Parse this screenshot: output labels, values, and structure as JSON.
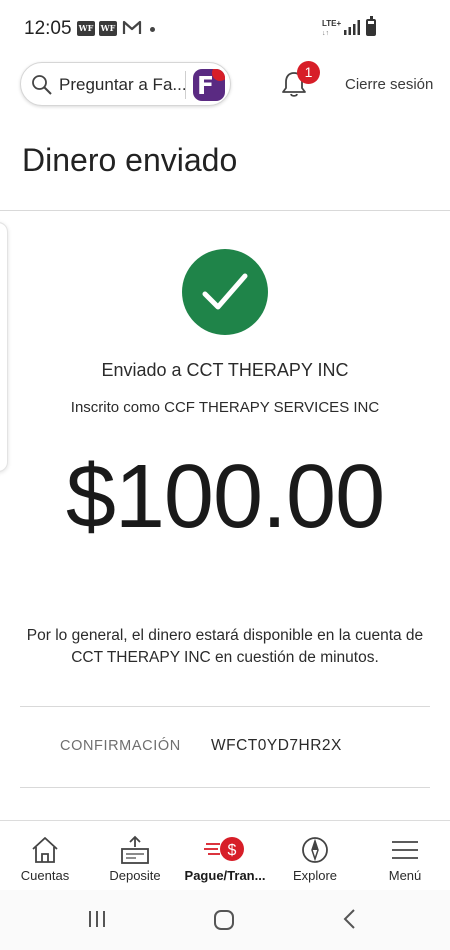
{
  "status_bar": {
    "time": "12:05",
    "app_icon_1": "WF",
    "app_icon_2": "WF",
    "network": "LTE+"
  },
  "header": {
    "search_placeholder": "Preguntar a Fa...",
    "notification_count": "1",
    "logout_label": "Cierre sesión"
  },
  "page": {
    "title": "Dinero enviado"
  },
  "confirmation": {
    "sent_to": "Enviado a CCT THERAPY INC",
    "enrolled_as": "Inscrito como CCF THERAPY SERVICES INC",
    "amount": "$100.00",
    "availability_note": "Por lo general, el dinero estará disponible en la cuenta de CCT THERAPY INC en cuestión de minutos.",
    "confirmation_label": "CONFIRMACIÓN",
    "confirmation_code": "WFCT0YD7HR2X"
  },
  "bottom_nav": {
    "items": [
      {
        "label": "Cuentas",
        "icon": "home-icon"
      },
      {
        "label": "Deposite",
        "icon": "deposit-icon"
      },
      {
        "label": "Pague/Tran...",
        "icon": "pay-transfer-icon"
      },
      {
        "label": "Explore",
        "icon": "compass-icon"
      },
      {
        "label": "Menú",
        "icon": "menu-icon"
      }
    ],
    "active_index": 2
  },
  "colors": {
    "success_green": "#1f8449",
    "alert_red": "#d71e28",
    "fargo_purple": "#5a2a82"
  }
}
